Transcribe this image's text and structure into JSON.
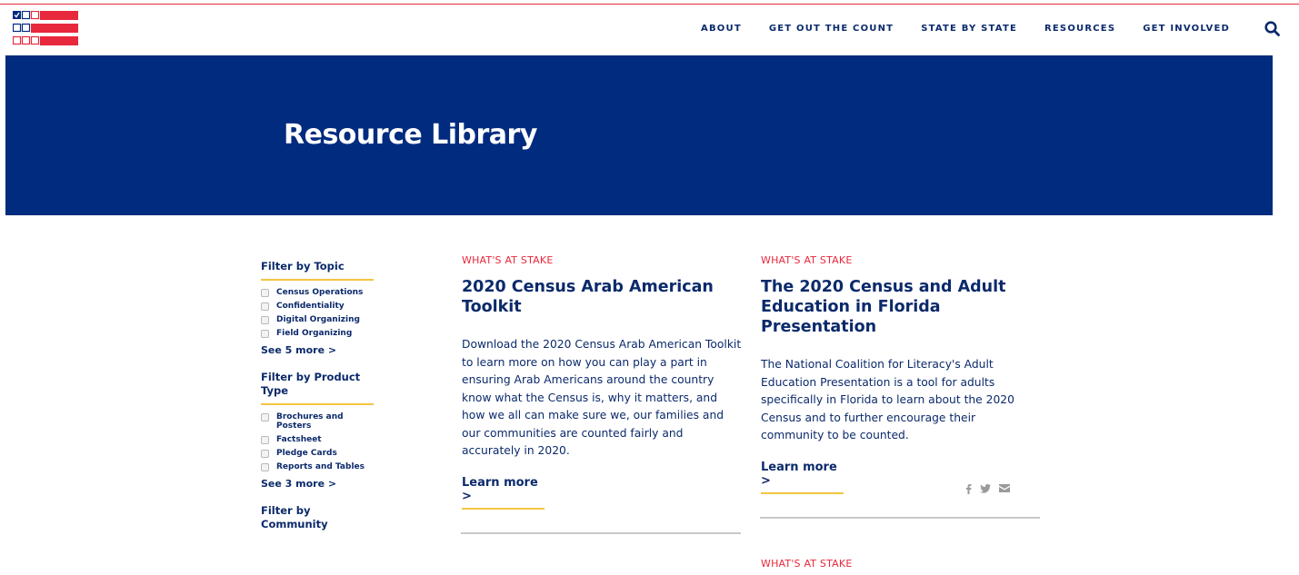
{
  "header": {
    "nav": [
      "ABOUT",
      "GET OUT THE COUNT",
      "STATE BY STATE",
      "RESOURCES",
      "GET INVOLVED"
    ]
  },
  "hero": {
    "title": "Resource Library"
  },
  "sidebar": {
    "topic_title": "Filter by Topic",
    "topics": [
      "Census Operations",
      "Confidentiality",
      "Digital Organizing",
      "Field Organizing"
    ],
    "topic_more": "See 5 more >",
    "product_title": "Filter by Product Type",
    "products": [
      "Brochures and Posters",
      "Factsheet",
      "Pledge Cards",
      "Reports and Tables"
    ],
    "product_more": "See 3 more >",
    "community_title": "Filter by Community"
  },
  "cards": [
    {
      "eyebrow": "WHAT'S AT STAKE",
      "title": "2020 Census Arab American Toolkit",
      "body": "Download the 2020 Census Arab American Toolkit to learn more on how you can play a part in ensuring Arab Americans around the country know what the Census is, why it matters, and how we all can make sure we, our families and our communities are counted fairly and accurately in 2020.",
      "link": "Learn more >"
    },
    {
      "eyebrow": "WHAT'S AT STAKE",
      "title": "The 2020 Census and Adult Education in Florida Presentation",
      "body": "The National Coalition for Literacy's Adult Education Presentation is a tool for adults specifically in Florida to learn about the 2020 Census and to further encourage their community to be counted.",
      "link": "Learn more >"
    },
    {
      "eyebrow": "WHAT'S AT STAKE"
    }
  ],
  "colors": {
    "navy": "#002b7f",
    "red": "#e8283c",
    "gold": "#f4c542"
  },
  "icons": [
    "logo-icon",
    "search-icon",
    "facebook-icon",
    "twitter-icon",
    "email-icon"
  ]
}
